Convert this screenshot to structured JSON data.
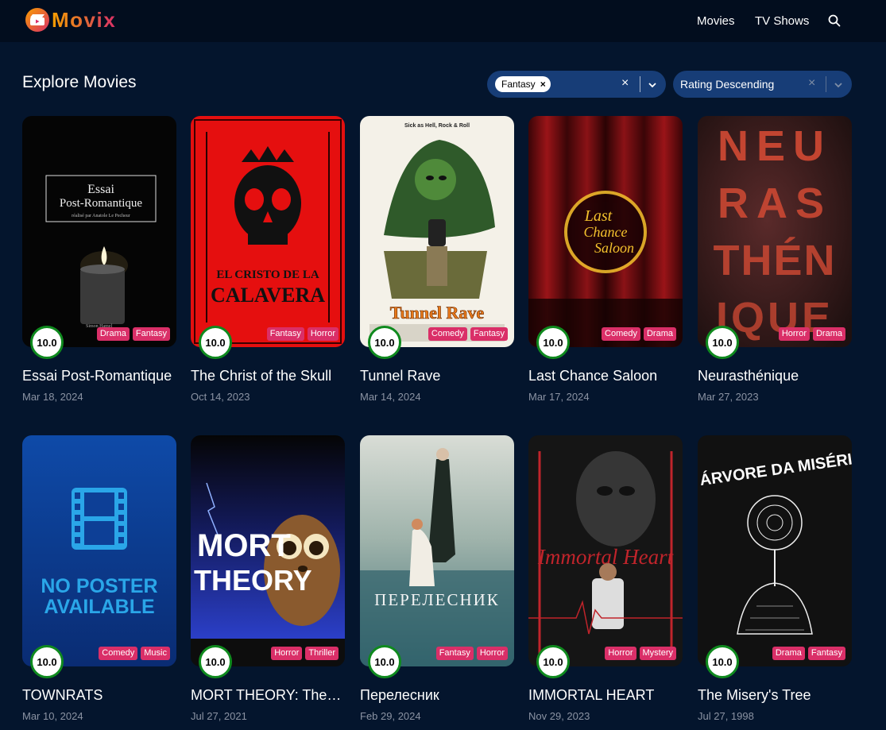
{
  "app": {
    "name": "Movix"
  },
  "nav": {
    "movies": "Movies",
    "tv_shows": "TV Shows",
    "search_icon": "search-icon"
  },
  "page": {
    "title": "Explore Movies"
  },
  "filters": {
    "genre_chip": "Fantasy",
    "genre_clear": "×",
    "sort_value": "Rating Descending",
    "sort_clear": "×"
  },
  "colors": {
    "background": "#04152d",
    "header": "#020d1e",
    "accent_orange": "#f89e00",
    "accent_pink": "#da2f68",
    "rating_ring": "#0f8a1e",
    "select_bg": "#173d77"
  },
  "movies": [
    {
      "title": "Essai Post-Romantique",
      "date": "Mar 18, 2024",
      "rating": "10.0",
      "genres": [
        "Drama",
        "Fantasy"
      ],
      "poster_text": [
        "Essai",
        "Post-Romantique",
        "réalisé par Anatole Le Pecheur",
        "Simon Hamel"
      ]
    },
    {
      "title": "The Christ of the Skull",
      "date": "Oct 14, 2023",
      "rating": "10.0",
      "genres": [
        "Fantasy",
        "Horror"
      ],
      "poster_text": [
        "EL CRISTO DE LA",
        "CALAVERA"
      ]
    },
    {
      "title": "Tunnel Rave",
      "date": "Mar 14, 2024",
      "rating": "10.0",
      "genres": [
        "Comedy",
        "Fantasy"
      ],
      "poster_text": [
        "Sick as Hell, Rock & Roll",
        "Tunnel Rave"
      ]
    },
    {
      "title": "Last Chance Saloon",
      "date": "Mar 17, 2024",
      "rating": "10.0",
      "genres": [
        "Comedy",
        "Drama"
      ],
      "poster_text": [
        "Last",
        "Chance",
        "Saloon"
      ]
    },
    {
      "title": "Neurasthénique",
      "date": "Mar 27, 2023",
      "rating": "10.0",
      "genres": [
        "Horror",
        "Drama"
      ],
      "poster_text": [
        "NEU",
        "RAS",
        "THÉN",
        "IQUE"
      ]
    },
    {
      "title": "TOWNRATS",
      "date": "Mar 10, 2024",
      "rating": "10.0",
      "genres": [
        "Comedy",
        "Music"
      ],
      "poster_text": [
        "NO POSTER",
        "AVAILABLE"
      ]
    },
    {
      "title": "MORT THEORY: The…",
      "date": "Jul 27, 2021",
      "rating": "10.0",
      "genres": [
        "Horror",
        "Thriller"
      ],
      "poster_text": [
        "MORT",
        "THEORY"
      ]
    },
    {
      "title": "Перелесник",
      "date": "Feb 29, 2024",
      "rating": "10.0",
      "genres": [
        "Fantasy",
        "Horror"
      ],
      "poster_text": [
        "ПЕРЕЛЕСНИК"
      ]
    },
    {
      "title": "IMMORTAL HEART",
      "date": "Nov 29, 2023",
      "rating": "10.0",
      "genres": [
        "Horror",
        "Mystery"
      ],
      "poster_text": [
        "Immortal Heart"
      ]
    },
    {
      "title": "The Misery's Tree",
      "date": "Jul 27, 1998",
      "rating": "10.0",
      "genres": [
        "Drama",
        "Fantasy"
      ],
      "poster_text": [
        "A ÁRVORE DA MISÉRIA"
      ]
    }
  ]
}
